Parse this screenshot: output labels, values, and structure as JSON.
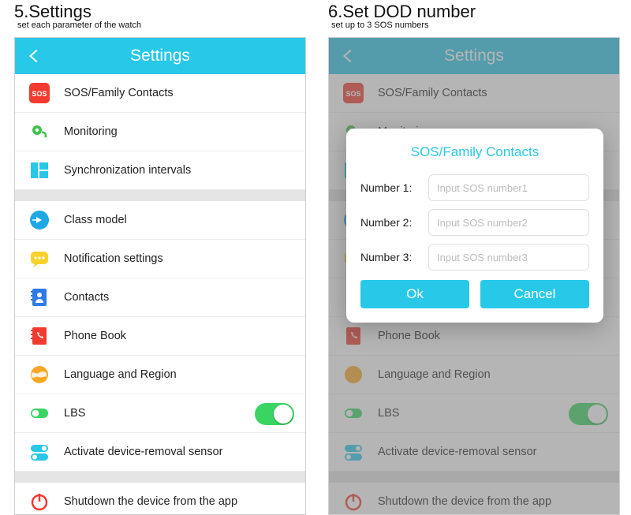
{
  "left": {
    "step_title": "5.Settings",
    "step_sub": "set each parameter of the watch",
    "header": "Settings",
    "group1": [
      {
        "icon": "sos",
        "label": "SOS/Family Contacts"
      },
      {
        "icon": "monitor",
        "label": "Monitoring"
      },
      {
        "icon": "sync",
        "label": "Synchronization intervals"
      }
    ],
    "group2": [
      {
        "icon": "class",
        "label": "Class model"
      },
      {
        "icon": "notif",
        "label": "Notification settings"
      },
      {
        "icon": "contacts",
        "label": "Contacts"
      },
      {
        "icon": "phonebook",
        "label": "Phone Book"
      },
      {
        "icon": "lang",
        "label": "Language and Region"
      },
      {
        "icon": "lbs",
        "label": "LBS",
        "toggle": true
      },
      {
        "icon": "removal",
        "label": "Activate device-removal sensor"
      }
    ],
    "group3": [
      {
        "icon": "shutdown",
        "label": "Shutdown the device from the app"
      }
    ]
  },
  "right": {
    "step_title": "6.Set DOD number",
    "step_sub": "set up to 3 SOS numbers",
    "header": "Settings",
    "modal": {
      "title": "SOS/Family Contacts",
      "fields": [
        {
          "label": "Number 1:",
          "placeholder": "Input SOS number1"
        },
        {
          "label": "Number 2:",
          "placeholder": "Input SOS number2"
        },
        {
          "label": "Number 3:",
          "placeholder": "Input SOS number3"
        }
      ],
      "ok": "Ok",
      "cancel": "Cancel"
    }
  }
}
